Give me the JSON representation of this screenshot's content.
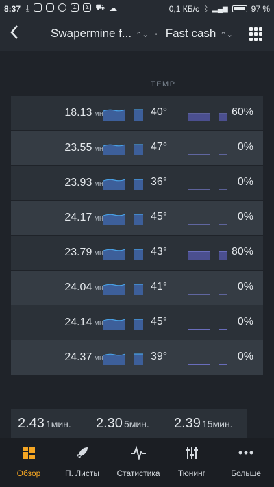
{
  "status": {
    "time": "8:37",
    "speed": "0,1 КБ/с",
    "battery": "97 %"
  },
  "header": {
    "back_label": "‹",
    "rig": "Swapermine f...",
    "separator": "·",
    "wallet": "Fast cash"
  },
  "table": {
    "temp_header": "TEMP",
    "rows": [
      {
        "hashrate": "18.13",
        "unit": "мн",
        "temp": "40°",
        "fan": "60%"
      },
      {
        "hashrate": "23.55",
        "unit": "мн",
        "temp": "47°",
        "fan": "0%"
      },
      {
        "hashrate": "23.93",
        "unit": "мн",
        "temp": "36°",
        "fan": "0%"
      },
      {
        "hashrate": "24.17",
        "unit": "мн",
        "temp": "45°",
        "fan": "0%"
      },
      {
        "hashrate": "23.79",
        "unit": "мн",
        "temp": "43°",
        "fan": "80%"
      },
      {
        "hashrate": "24.04",
        "unit": "мн",
        "temp": "41°",
        "fan": "0%"
      },
      {
        "hashrate": "24.14",
        "unit": "мн",
        "temp": "45°",
        "fan": "0%"
      },
      {
        "hashrate": "24.37",
        "unit": "мн",
        "temp": "39°",
        "fan": "0%"
      }
    ]
  },
  "load": [
    {
      "value": "2.43",
      "unit": "1мин."
    },
    {
      "value": "2.30",
      "unit": "5мин."
    },
    {
      "value": "2.39",
      "unit": "15мин."
    }
  ],
  "nav": [
    {
      "label": "Обзор",
      "icon": "dashboard-icon",
      "active": true
    },
    {
      "label": "П. Листы",
      "icon": "rocket-icon",
      "active": false
    },
    {
      "label": "Статистика",
      "icon": "pulse-icon",
      "active": false
    },
    {
      "label": "Тюнинг",
      "icon": "sliders-icon",
      "active": false
    },
    {
      "label": "Больше",
      "icon": "more-icon",
      "active": false
    }
  ],
  "colors": {
    "accent": "#f5a623",
    "spark_fill": "#3d5f9a",
    "spark_line": "#4aa3e8",
    "fan_fill": "#4b4f8f",
    "fan_line": "#7b7fd6"
  }
}
